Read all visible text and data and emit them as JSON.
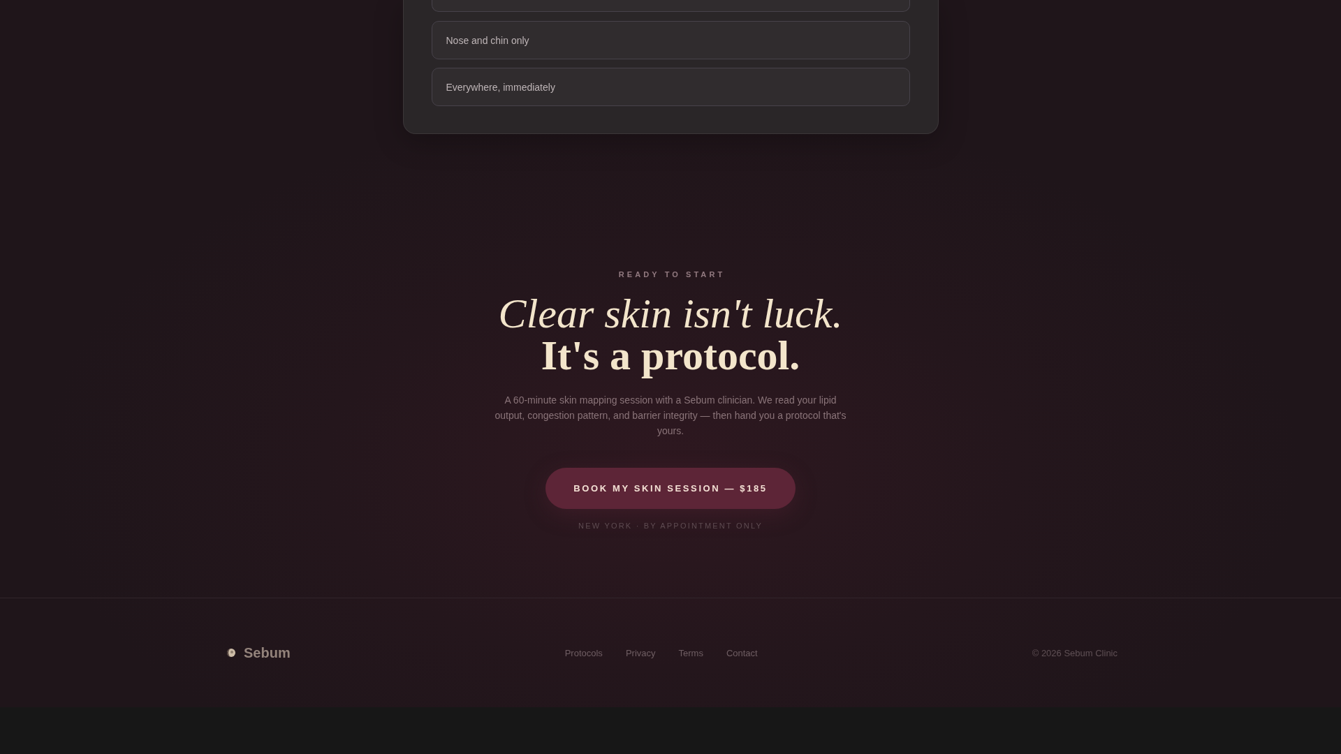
{
  "quiz_card": {
    "options": [
      {
        "label": "Nose and chin only",
        "selected": false
      },
      {
        "label": "Everywhere, immediately",
        "selected": false
      }
    ]
  },
  "cta": {
    "eyebrow": "READY TO START",
    "headline_italic": "Clear skin isn't luck.",
    "headline_bold": "It's a protocol.",
    "description": "A 60-minute skin mapping session with a Sebum clinician. We read your lipid output, congestion pattern, and barrier integrity — then hand you a protocol that's yours.",
    "button": "BOOK MY SKIN SESSION — $185",
    "note": "NEW YORK · BY APPOINTMENT ONLY"
  },
  "footer": {
    "brand": "Sebum",
    "links": [
      "Protocols",
      "Privacy",
      "Terms",
      "Contact"
    ],
    "copyright": "© 2026 Sebum Clinic"
  }
}
